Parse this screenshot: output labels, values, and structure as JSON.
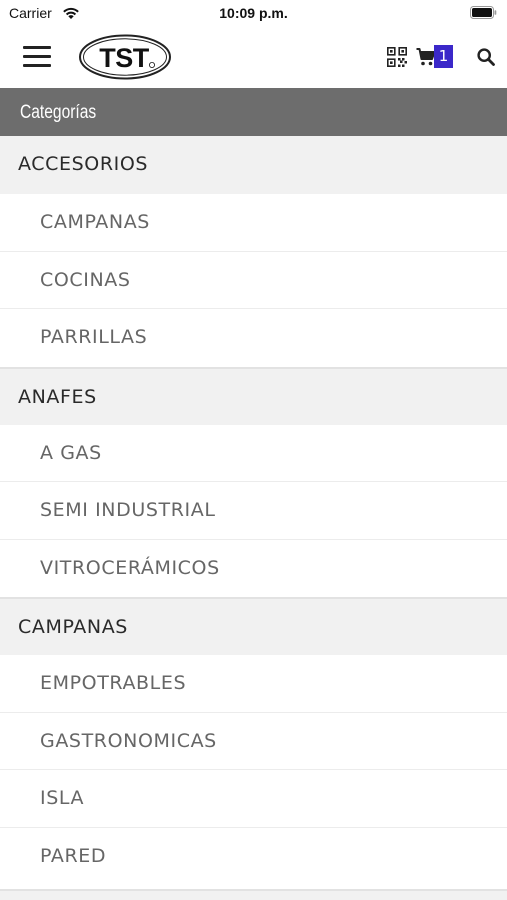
{
  "status_bar": {
    "carrier": "Carrier",
    "time": "10:09 p.m."
  },
  "header": {
    "logo_text": "TST",
    "cart_count": "1",
    "icons": [
      "menu-icon",
      "qr-code-icon",
      "cart-icon",
      "search-icon"
    ]
  },
  "section": {
    "title": "Categorías"
  },
  "categories": [
    {
      "name": "ACCESORIOS",
      "items": [
        "CAMPANAS",
        "COCINAS",
        "PARRILLAS"
      ]
    },
    {
      "name": "ANAFES",
      "items": [
        "A GAS",
        "SEMI INDUSTRIAL",
        "VITROCERÁMICOS"
      ]
    },
    {
      "name": "CAMPANAS",
      "items": [
        "EMPOTRABLES",
        "GASTRONOMICAS",
        "ISLA",
        "PARED"
      ]
    }
  ],
  "colors": {
    "section_bar": "#6d6d6d",
    "category_header_bg": "#f1f1f1",
    "badge": "#3b28c9"
  }
}
